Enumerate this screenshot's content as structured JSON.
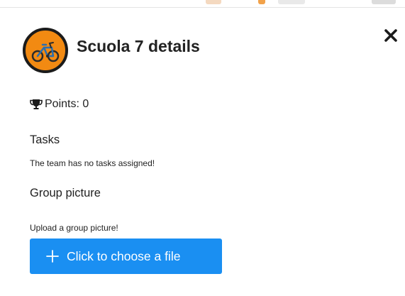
{
  "dialog": {
    "title": "Scuola 7 details",
    "close_icon": "close-icon",
    "avatar_icon": "bicycle-avatar-icon",
    "points_icon": "trophy-icon",
    "points_label": "Points: 0",
    "tasks_heading": "Tasks",
    "tasks_message": "The team has no tasks assigned!",
    "group_picture_heading": "Group picture",
    "upload_message": "Upload a group picture!",
    "choose_file_button": {
      "label": "Click to choose a file",
      "icon": "plus-icon"
    }
  },
  "colors": {
    "primary_button": "#1a8ff2",
    "avatar_background": "#f28a12",
    "text": "#222222"
  }
}
